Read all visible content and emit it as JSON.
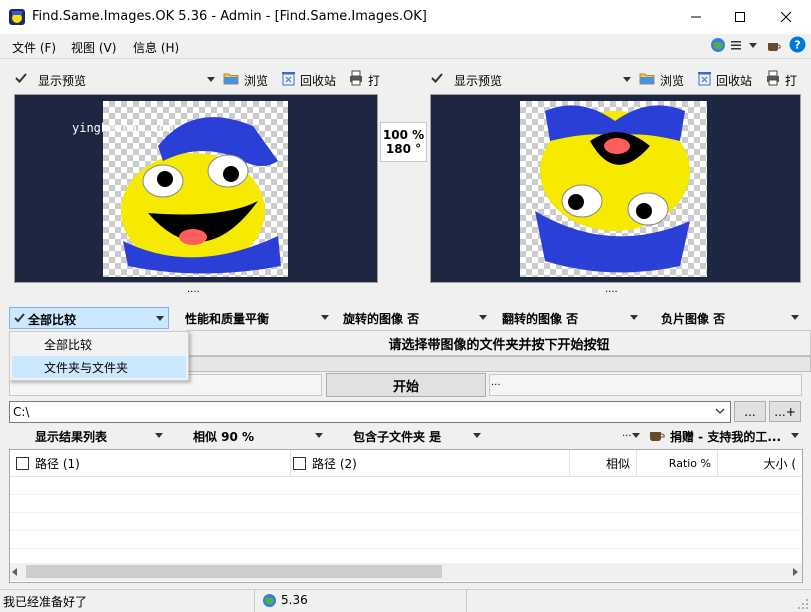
{
  "window": {
    "title": "Find.Same.Images.OK 5.36 - Admin - [Find.Same.Images.OK]"
  },
  "menu": {
    "file": "文件 (F)",
    "view": "视图 (V)",
    "info": "信息 (H)"
  },
  "left_toolbar": {
    "preview_label": "显示预览",
    "browse_label": "浏览",
    "recycle_label": "回收站",
    "print_label": "打"
  },
  "right_toolbar": {
    "preview_label": "显示预览",
    "browse_label": "浏览",
    "recycle_label": "回收站",
    "print_label": "打"
  },
  "watermark": "yinghezhan.com",
  "compare_info": {
    "zoom": "100 %",
    "rotation": "180 °"
  },
  "splitter_dots": "....",
  "options": {
    "mode_selected": "全部比较",
    "mode_options": [
      "全部比较",
      "文件夹与文件夹"
    ],
    "performance": "性能和质量平衡",
    "rotated": "旋转的图像 否",
    "flipped": "翻转的图像 否",
    "negative": "负片图像 否"
  },
  "instruction": "请选择带图像的文件夹并按下开始按钮",
  "side_dots_left": "...",
  "side_dots_right": "...",
  "start_button": "开始",
  "path": {
    "value": "C:\\",
    "browse_btn": "...",
    "add_btn": "...+"
  },
  "results_bar": {
    "view_mode": "显示结果列表",
    "similarity": "相似 90 %",
    "subfolders": "包含子文件夹 是",
    "more": "...",
    "donate": "捐赠 - 支持我的工..."
  },
  "grid": {
    "columns": [
      "路径 (1)",
      "路径 (2)",
      "相似",
      "Ratio %",
      "大小 ("
    ]
  },
  "status": {
    "message": "我已经准备好了",
    "version": "5.36"
  },
  "colors": {
    "accent": "#0078d7",
    "preview_bg": "#1c2640",
    "highlight": "#cce8ff"
  }
}
